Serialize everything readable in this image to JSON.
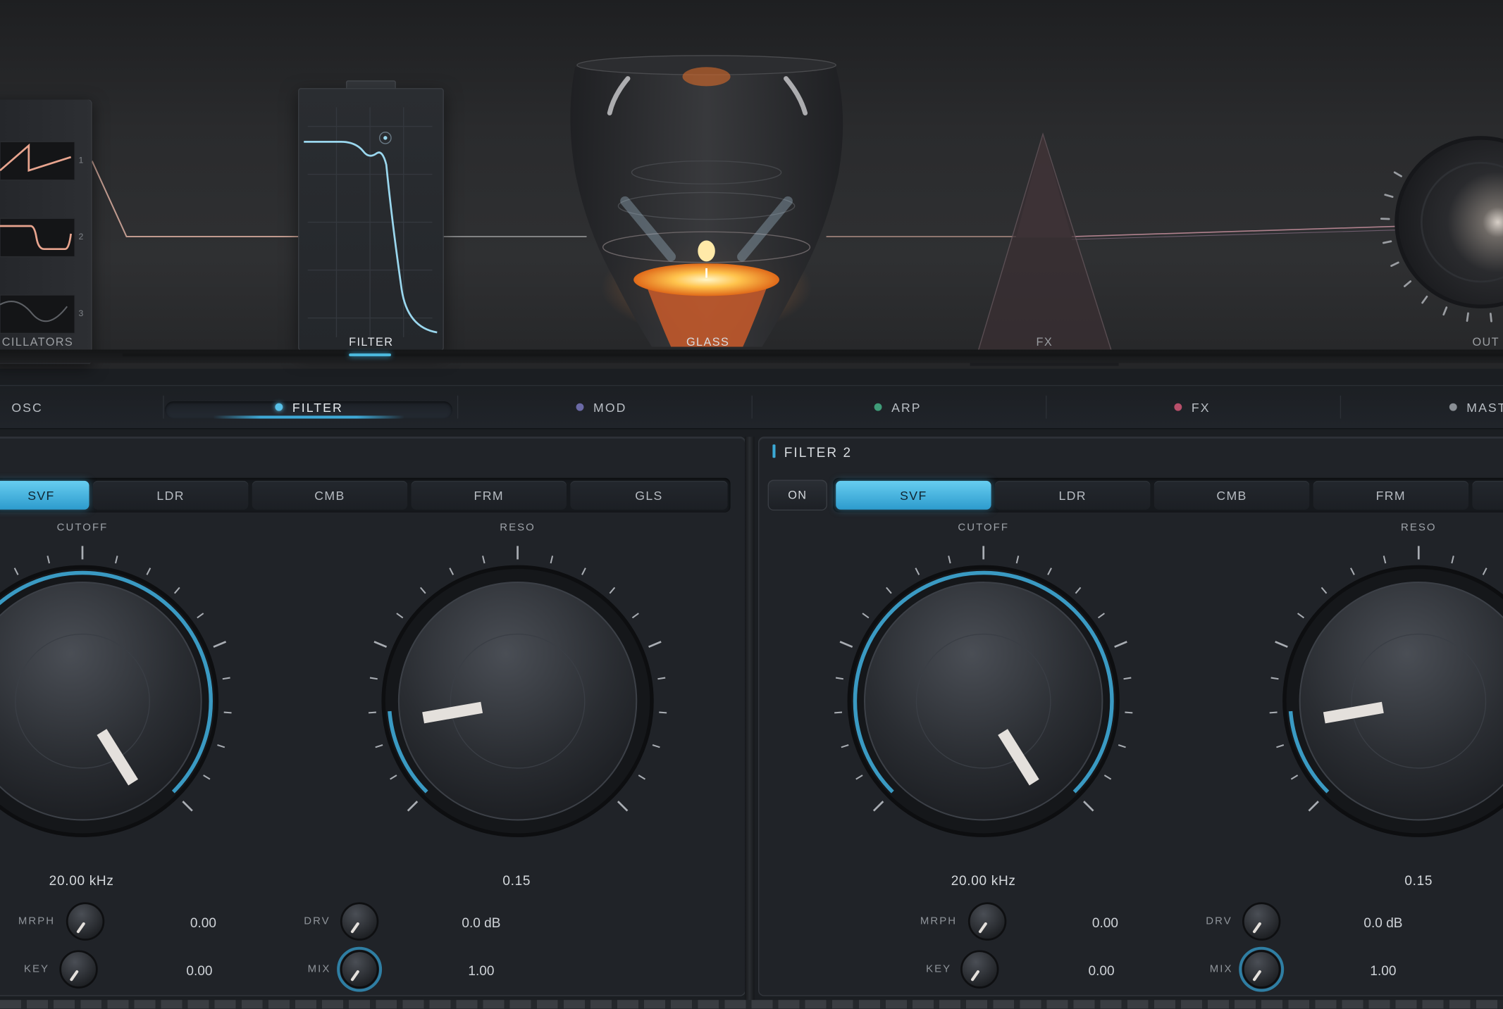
{
  "stations": {
    "oscillators": "CILLATORS",
    "filter": "FILTER",
    "glass": "GLASS",
    "fx": "FX",
    "out": "OUT",
    "osc_numbers": [
      "1",
      "2",
      "3"
    ]
  },
  "tabs": [
    {
      "label": "OSC",
      "dot": ""
    },
    {
      "label": "FILTER",
      "dot": "#58c1e8",
      "active": true
    },
    {
      "label": "MOD",
      "dot": "#6b6aa6"
    },
    {
      "label": "ARP",
      "dot": "#3f9c78"
    },
    {
      "label": "FX",
      "dot": "#b84f6a"
    },
    {
      "label": "MAST",
      "dot": "#8a8f95"
    }
  ],
  "filter1": {
    "types": [
      "SVF",
      "LDR",
      "CMB",
      "FRM",
      "GLS"
    ],
    "selected": "SVF",
    "cutoff": {
      "label": "CUTOFF",
      "value": "20.00 kHz",
      "level": 1.0
    },
    "reso": {
      "label": "RESO",
      "value": "0.15",
      "level": 0.15
    },
    "mrph": {
      "label": "MRPH",
      "value": "0.00"
    },
    "key": {
      "label": "KEY",
      "value": "0.00"
    },
    "drv": {
      "label": "DRV",
      "value": "0.0 dB"
    },
    "mix": {
      "label": "MIX",
      "value": "1.00"
    }
  },
  "filter2": {
    "title": "FILTER 2",
    "on_label": "ON",
    "types": [
      "SVF",
      "LDR",
      "CMB",
      "FRM"
    ],
    "selected": "SVF",
    "cutoff": {
      "label": "CUTOFF",
      "value": "20.00 kHz",
      "level": 1.0
    },
    "reso": {
      "label": "RESO",
      "value": "0.15",
      "level": 0.15
    },
    "mrph": {
      "label": "MRPH",
      "value": "0.00"
    },
    "key": {
      "label": "KEY",
      "value": "0.00"
    },
    "drv": {
      "label": "DRV",
      "value": "0.0 dB"
    },
    "mix": {
      "label": "MIX",
      "value": "1.00"
    }
  },
  "colors": {
    "accent": "#3ea9d6",
    "flame": "#ffb347",
    "signal": "#e6b7a8"
  }
}
